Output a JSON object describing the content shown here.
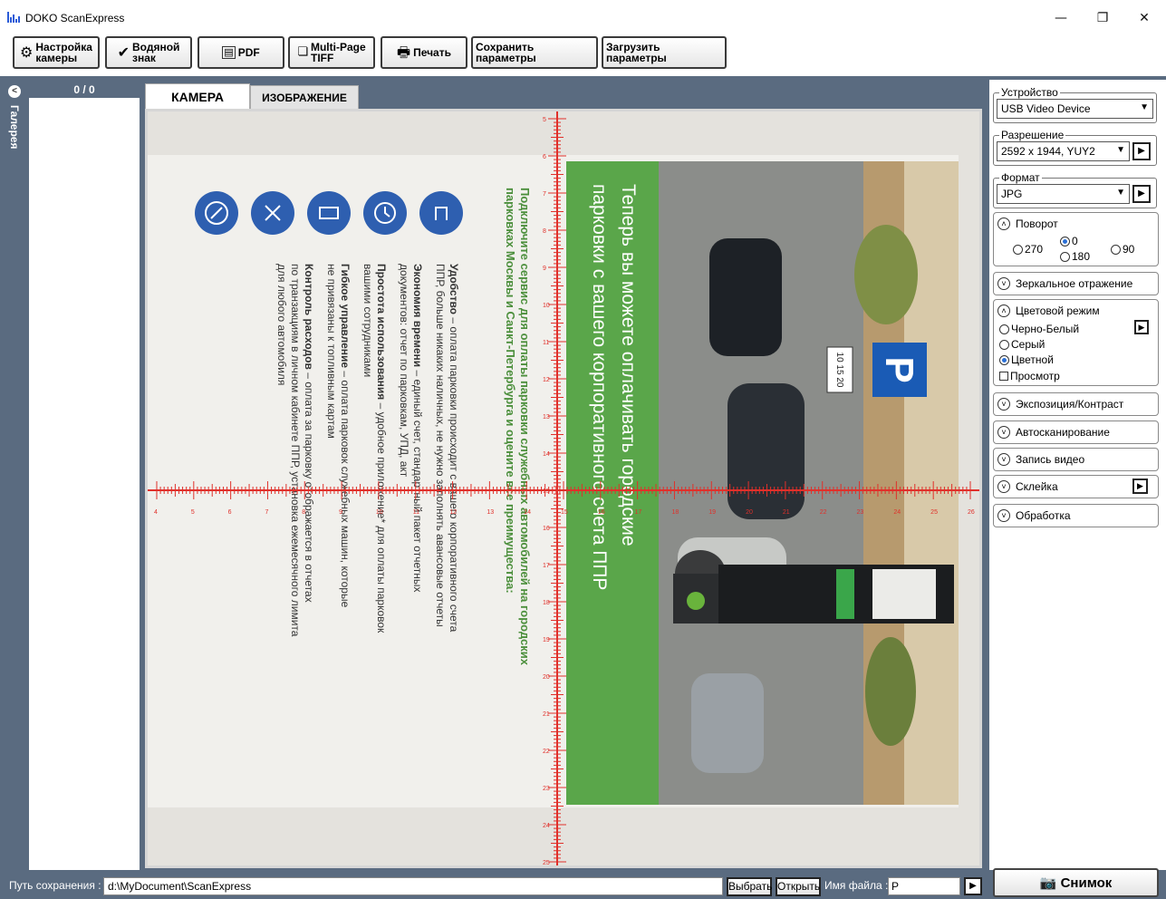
{
  "app": {
    "title": "DOKO ScanExpress"
  },
  "window_controls": {
    "minimize": "—",
    "restore": "❐",
    "close": "✕"
  },
  "toolbar": {
    "camera_settings": "Настройка\nкамеры",
    "watermark": "Водяной\nзнак",
    "pdf": "PDF",
    "multipage_tiff": "Multi-Page\nTIFF",
    "print": "Печать",
    "save_params": "Сохранить параметры",
    "load_params": "Загрузить параметры"
  },
  "gallery": {
    "label": "Галерея",
    "count": "0 / 0"
  },
  "tabs": {
    "camera": "КАМЕРА",
    "image": "ИЗОБРАЖЕНИЕ"
  },
  "document": {
    "headline_line1": "Теперь вы можете оплачивать городские",
    "headline_line2": "парковки с вашего корпоративного счета ППР",
    "subtitle_line1": "Подключите сервис для оплаты парковки служебных автомобилей на городских",
    "subtitle_line2": "парковках Москвы и Санкт-Петербурга и оцените все преимущества:",
    "items": [
      {
        "bold": "Удобство",
        "text": " – оплата парковки происходит с вашего корпоративного счета",
        "line2": "ППР, больше никаких наличных, не нужно заполнять авансовые отчеты"
      },
      {
        "bold": "Экономия времени",
        "text": " – единый счет, стандартный пакет отчетных",
        "line2": "документов: отчет по парковкам, УПД, акт"
      },
      {
        "bold": "Простота использования",
        "text": " – удобное приложение* для оплаты парковок",
        "line2": "вашими сотрудниками"
      },
      {
        "bold": "Гибкое управление",
        "text": " – оплата парковок служебных машин, которые",
        "line2": "не привязаны к топливным картам"
      },
      {
        "bold": "Контроль расходов",
        "text": " – оплата за парковку отображается в отчетах",
        "line2": "по транзакциям в личном кабинете ППР, установка ежемесячного лимита",
        "line3": "для любого автомобиля"
      }
    ],
    "parking_sign": "P",
    "parking_hours": "10 15 20",
    "ruler_v": [
      "5",
      "6",
      "7",
      "8",
      "9",
      "10",
      "11",
      "12",
      "13",
      "14",
      "15",
      "16",
      "17",
      "18",
      "19",
      "20",
      "21",
      "22",
      "23",
      "24",
      "25"
    ],
    "ruler_h": [
      "4",
      "5",
      "6",
      "7",
      "8",
      "9",
      "10",
      "11",
      "12",
      "13",
      "14",
      "15",
      "16",
      "17",
      "18",
      "19",
      "20",
      "21",
      "22",
      "23",
      "24",
      "25",
      "26"
    ]
  },
  "colors": {
    "accent": "#5a6b80",
    "green": "#5aa64a",
    "ruler": "#e0302a",
    "icon_blue": "#2e5fb0"
  },
  "right_panel": {
    "device": {
      "legend": "Устройство",
      "value": "USB Video Device"
    },
    "resolution": {
      "legend": "Разрешение",
      "value": "2592 x 1944, YUY2"
    },
    "format": {
      "legend": "Формат",
      "value": "JPG"
    },
    "rotation": {
      "title": "Поворот",
      "options": [
        "270",
        "0",
        "180",
        "90"
      ],
      "selected": "0"
    },
    "mirror": "Зеркальное отражение",
    "color_mode": {
      "title": "Цветовой режим",
      "options": [
        "Черно-Белый",
        "Серый",
        "Цветной"
      ],
      "selected": "Цветной",
      "preview": "Просмотр"
    },
    "exposure": "Экспозиция/Контраст",
    "autoscan": "Автосканирование",
    "video": "Запись видео",
    "stitch": "Склейка",
    "processing": "Обработка",
    "snapshot": "Снимок"
  },
  "bottom": {
    "path_label": "Путь сохранения :",
    "path_value": "d:\\MyDocument\\ScanExpress",
    "choose": "Выбрать",
    "open": "Открыть",
    "filename_label": "Имя файла :",
    "filename_value": "P"
  }
}
